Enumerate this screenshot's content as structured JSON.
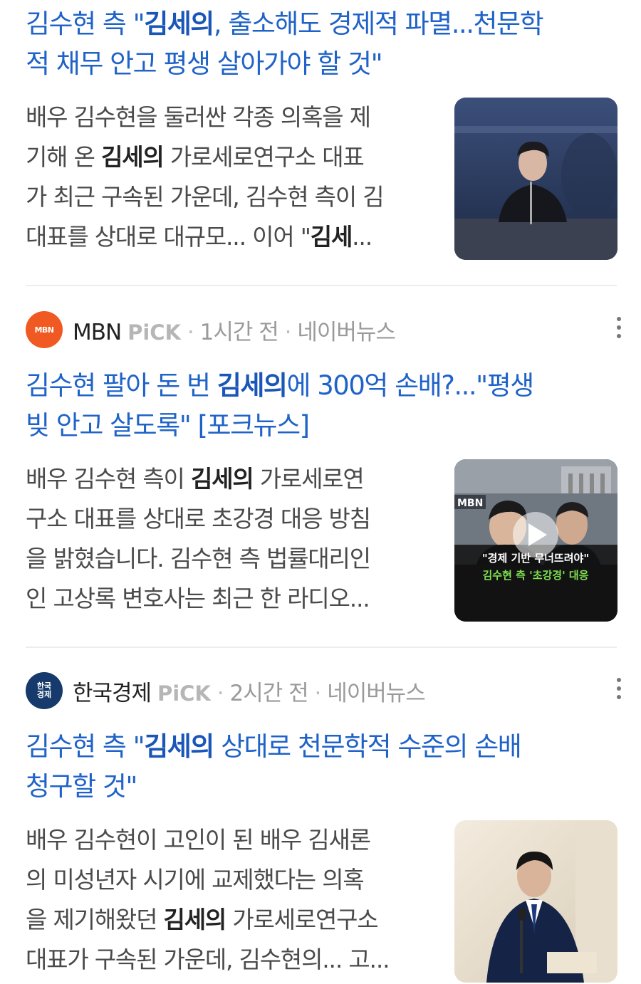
{
  "articles": [
    {
      "title_lines": [
        [
          "김수현 측 \"",
          "김세의",
          ", 출소해도 경제적 파멸...천문학"
        ],
        [
          "적 채무 안고 평생 살아가야 할 것\"",
          "",
          ""
        ]
      ],
      "snippet_lines": [
        [
          "배우 김수현을 둘러싼 각종 의혹을 제",
          "",
          ""
        ],
        [
          "기해 온 ",
          "김세의",
          " 가로세로연구소 대표"
        ],
        [
          "가 최근 구속된 가운데, 김수현 측이 김",
          "",
          ""
        ],
        [
          "대표를 상대로 대규모... 이어 \"",
          "김세",
          "..."
        ]
      ],
      "thumbnail": "press-conference-photo"
    },
    {
      "source": {
        "name": "MBN",
        "logo_text": "MBN",
        "pick": "PiCK",
        "time": "1시간 전",
        "platform": "네이버뉴스"
      },
      "title_lines": [
        [
          "김수현 팔아 돈 번 ",
          "김세의",
          "에 300억 손배?...\"평생"
        ],
        [
          "빚 안고 살도록\" [포크뉴스]",
          "",
          ""
        ]
      ],
      "snippet_lines": [
        [
          "배우 김수현 측이 ",
          "김세의",
          " 가로세로연"
        ],
        [
          "구소 대표를 상대로 초강경 대응 방침",
          "",
          ""
        ],
        [
          "을 밝혔습니다. 김수현 측 법률대리인",
          "",
          ""
        ],
        [
          "인 고상록 변호사는 최근 한 라디오...",
          "",
          ""
        ]
      ],
      "thumbnail": "video-thumbnail",
      "video": {
        "brand": "MBN",
        "caption_1": "\"경제 기반 무너뜨려야\"",
        "caption_2": "김수현 측 '초강경' 대응",
        "play_icon": "play-icon"
      }
    },
    {
      "source": {
        "name": "한국경제",
        "logo_text": "한국\n경제",
        "pick": "PiCK",
        "time": "2시간 전",
        "platform": "네이버뉴스"
      },
      "title_lines": [
        [
          "김수현 측 \"",
          "김세의",
          " 상대로 천문학적 수준의 손배"
        ],
        [
          "청구할 것\"",
          "",
          ""
        ]
      ],
      "snippet_lines": [
        [
          "배우 김수현이 고인이 된 배우 김새론",
          "",
          ""
        ],
        [
          "의 미성년자 시기에 교제했다는 의혹",
          "",
          ""
        ],
        [
          "을 제기해왔던 ",
          "김세의",
          " 가로세로연구소"
        ],
        [
          "대표가 구속된 가운데, 김수현의... 고...",
          "",
          ""
        ]
      ],
      "thumbnail": "lawyer-speaking-photo"
    }
  ],
  "colors": {
    "title": "#1f63c8",
    "snippet": "#4a4a4a",
    "mbn": "#f05a22",
    "hankyung": "#153a6b"
  }
}
